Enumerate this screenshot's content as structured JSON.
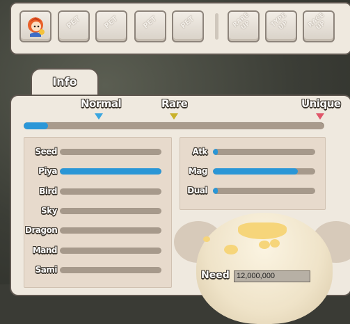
{
  "slots": {
    "first": {
      "icon": "character-portrait-icon"
    },
    "pet_slots": [
      "PET",
      "PET",
      "PET",
      "PET"
    ],
    "upgrades": [
      "RARE UP",
      "TYPE UP",
      "RACE UP"
    ]
  },
  "tab": {
    "label": "Info"
  },
  "grades": {
    "normal": "Normal",
    "rare": "Rare",
    "unique": "Unique",
    "progress": 0.08,
    "colors": {
      "normal": "#3aa6e0",
      "rare": "#c9b12a",
      "unique": "#e0566a"
    }
  },
  "type_stats": [
    {
      "label": "Seed",
      "value": 0.0
    },
    {
      "label": "Piya",
      "value": 1.0
    },
    {
      "label": "Bird",
      "value": 0.0
    },
    {
      "label": "Sky",
      "value": 0.0
    },
    {
      "label": "Dragon",
      "value": 0.0
    },
    {
      "label": "Mand",
      "value": 0.0
    },
    {
      "label": "Sami",
      "value": 0.0
    }
  ],
  "attr_stats": [
    {
      "label": "Atk",
      "value": 0.05
    },
    {
      "label": "Mag",
      "value": 0.83
    },
    {
      "label": "Dual",
      "value": 0.05
    }
  ],
  "need": {
    "label": "Need",
    "value": "12,000,000"
  },
  "colors": {
    "bar_fill": "#2a96d6",
    "bar_track": "#a6998b",
    "panel": "#efe9df"
  }
}
